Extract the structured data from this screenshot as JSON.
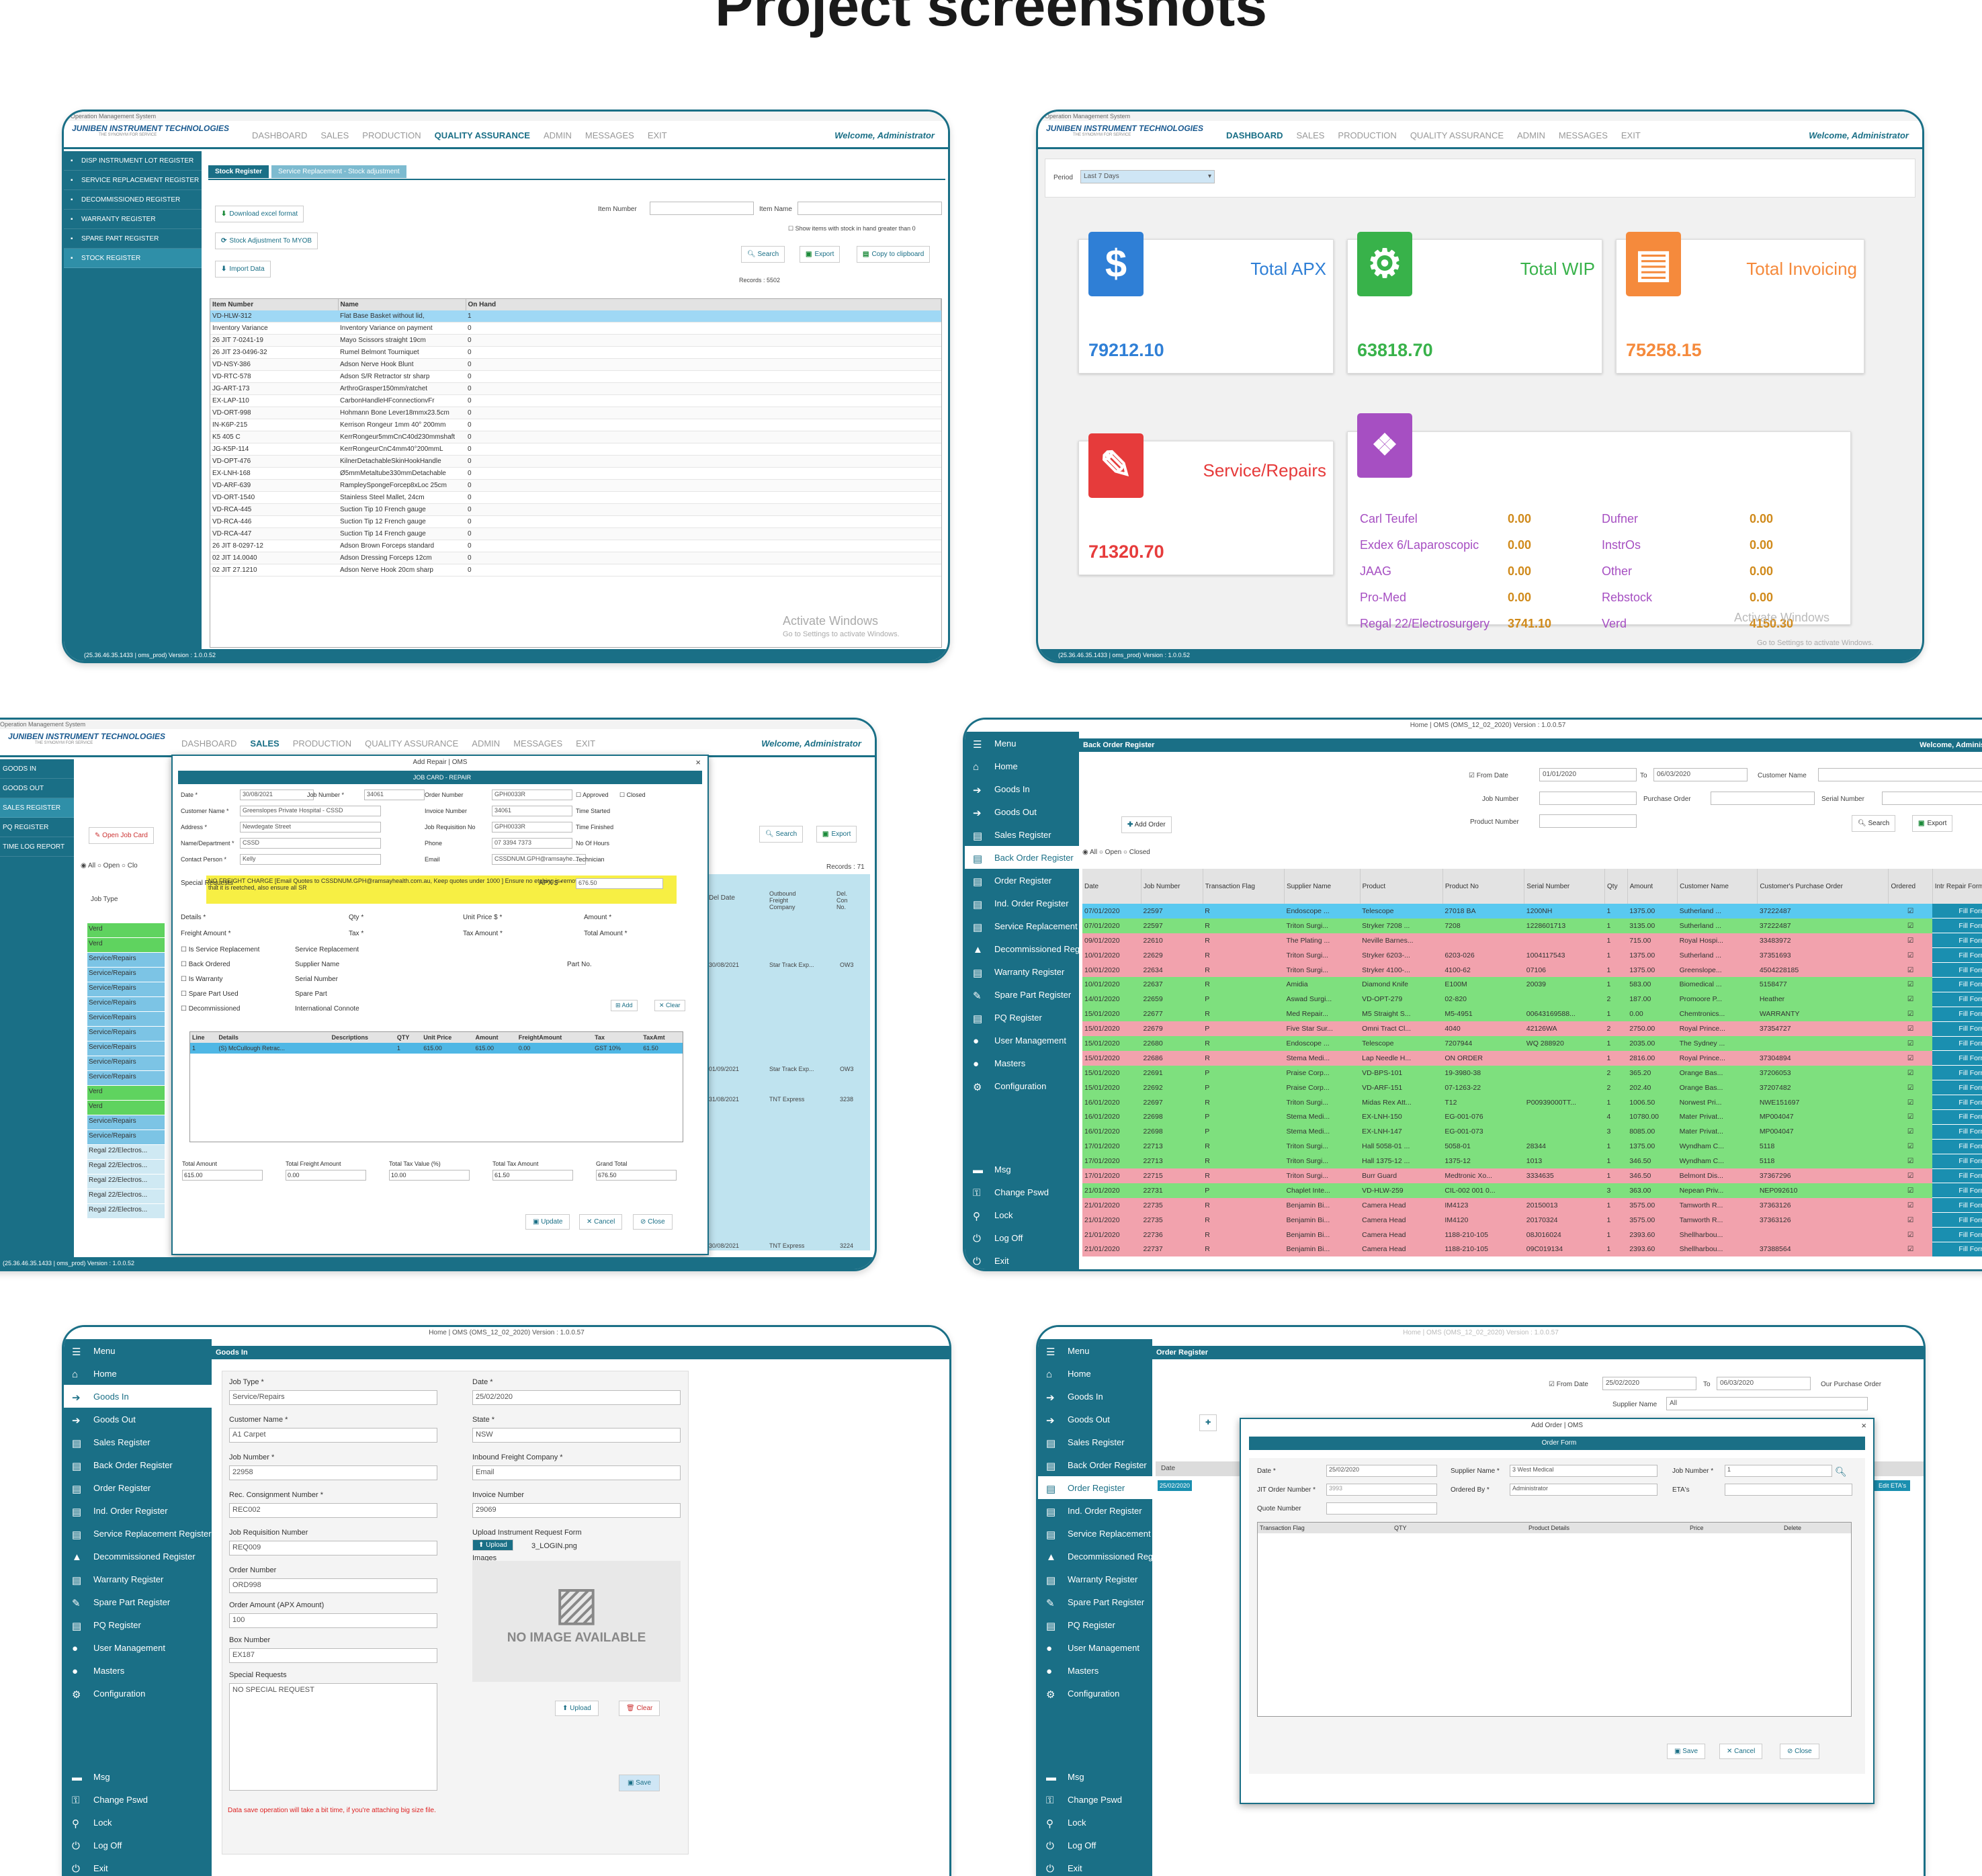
{
  "page_title": "Project screenshots",
  "common": {
    "window_title": "Operation Management System",
    "logo_text": "JUNIBEN INSTRUMENT TECHNOLOGIES",
    "logo_tagline": "THE SYNONYM FOR SERVICE",
    "welcome": "Welcome, Administrator",
    "nav": [
      "DASHBOARD",
      "SALES",
      "PRODUCTION",
      "QUALITY ASSURANCE",
      "ADMIN",
      "MESSAGES",
      "EXIT"
    ],
    "status": "(25.36.46.35.1433 | oms_prod) Version : 1.0.0.52",
    "activate": "Activate Windows",
    "activate_sub": "Go to Settings to activate Windows.",
    "menu_top_title": "Home | OMS (OMS_12_02_2020) Version : 1.0.0.57",
    "menu_label": "Menu",
    "lmenu": [
      "Home",
      "Goods In",
      "Goods Out",
      "Sales Register",
      "Back Order Register",
      "Order Register",
      "Ind. Order Register",
      "Service Replacement Register",
      "Decommissioned Register",
      "Warranty Register",
      "Spare Part Register",
      "PQ Register",
      "User Management",
      "Masters",
      "Configuration"
    ],
    "lmenu_bottom": [
      "Msg",
      "Change Pswd",
      "Lock",
      "Log Off",
      "Exit"
    ]
  },
  "shot1": {
    "side": [
      "DISP INSTRUMENT LOT REGISTER",
      "SERVICE REPLACEMENT REGISTER",
      "DECOMMISSIONED REGISTER",
      "WARRANTY REGISTER",
      "SPARE PART REGISTER",
      "STOCK REGISTER"
    ],
    "tabs": [
      "Stock Register",
      "Service Replacement - Stock adjustment"
    ],
    "download": "Download excel format",
    "adjust": "Stock Adjustment To MYOB",
    "import": "Import Data",
    "item_number_label": "Item Number",
    "item_name_label": "Item Name",
    "show_stock": "Show items with stock in hand greater than 0",
    "search": "Search",
    "export": "Export",
    "copy": "Copy to clipboard",
    "records": "Records : 5502",
    "columns": [
      "Item Number",
      "Name",
      "On Hand"
    ],
    "rows": [
      [
        "VD-HLW-312",
        "Flat Base Basket without lid,",
        "1"
      ],
      [
        "Inventory Variance",
        "Inventory Variance on payment",
        "0"
      ],
      [
        "26 JIT 7-0241-19",
        "Mayo Scissors straight 19cm",
        "0"
      ],
      [
        "26 JIT 23-0496-32",
        "Rumel Belmont Tourniquet",
        "0"
      ],
      [
        "VD-NSY-386",
        "Adson Nerve Hook Blunt",
        "0"
      ],
      [
        "VD-RTC-578",
        "Adson S/R Retractor str sharp",
        "0"
      ],
      [
        "JG-ART-173",
        "ArthroGrasper150mm/ratchet",
        "0"
      ],
      [
        "EX-LAP-110",
        "CarbonHandleHFconnectionvFr",
        "0"
      ],
      [
        "VD-ORT-998",
        "Hohmann Bone Lever18mmx23.5cm",
        "0"
      ],
      [
        "IN-K6P-215",
        "Kerrison Rongeur 1mm 40° 200mm",
        "0"
      ],
      [
        "K5 405 C",
        "KerrRongeur5mmCnC40d230mmshaft",
        "0"
      ],
      [
        "JG-K5P-114",
        "KerrRongeurCnC4mm40°200mmL",
        "0"
      ],
      [
        "VD-OPT-476",
        "KilnerDetachableSkinHookHandle",
        "0"
      ],
      [
        "EX-LNH-168",
        "Ø5mmMetaltube330mmDetachable",
        "0"
      ],
      [
        "VD-ARF-639",
        "RampleySpongeForcep8xLoc 25cm",
        "0"
      ],
      [
        "VD-ORT-1540",
        "Stainless Steel Mallet, 24cm",
        "0"
      ],
      [
        "VD-RCA-445",
        "Suction Tip 10 French gauge",
        "0"
      ],
      [
        "VD-RCA-446",
        "Suction Tip 12 French gauge",
        "0"
      ],
      [
        "VD-RCA-447",
        "Suction Tip 14 French gauge",
        "0"
      ],
      [
        "26 JIT 8-0297-12",
        "Adson Brown Forceps standard",
        "0"
      ],
      [
        "02 JIT 14.0040",
        "Adson Dressing Forceps 12cm",
        "0"
      ],
      [
        "02 JIT 27.1210",
        "Adson Nerve Hook 20cm sharp",
        "0"
      ]
    ]
  },
  "shot2": {
    "period_label": "Period",
    "period_value": "Last 7 Days",
    "cards": [
      {
        "title": "Total APX",
        "value": "79212.10",
        "color": "#2f7fd6",
        "icon": "$"
      },
      {
        "title": "Total WIP",
        "value": "63818.70",
        "color": "#38b24a",
        "icon": "⚙"
      },
      {
        "title": "Total Invoicing",
        "value": "75258.15",
        "color": "#f58a3c",
        "icon": "▤"
      },
      {
        "title": "Service/Repairs",
        "value": "71320.70",
        "color": "#e63b3b",
        "icon": "✎"
      }
    ],
    "stock": [
      [
        "Carl Teufel",
        "0.00",
        "Dufner",
        "0.00"
      ],
      [
        "Exdex 6/Laparoscopic",
        "0.00",
        "InstrOs",
        "0.00"
      ],
      [
        "JAAG",
        "0.00",
        "Other",
        "0.00"
      ],
      [
        "Pro-Med",
        "0.00",
        "Rebstock",
        "0.00"
      ],
      [
        "Regal 22/Electrosurgery",
        "3741.10",
        "Verd",
        "4150.30"
      ]
    ]
  },
  "shot3": {
    "side": [
      "GOODS IN",
      "GOODS OUT",
      "SALES REGISTER",
      "PQ REGISTER",
      "TIME LOG REPORT"
    ],
    "modal_title": "Add Repair | OMS",
    "job_card": "JOB CARD - REPAIR",
    "date": "30/08/2021",
    "job_number": "34061",
    "order_number": "GPH0033R",
    "customer": "Greenslopes Private Hospital - CSSD",
    "invoice_number": "34061",
    "address": "Newdegate Street",
    "job_req": "GPH0033R",
    "name_dept": "CSSD",
    "phone": "07 3394 7373",
    "contact": "Kelly",
    "email": "CSSDNUM.GPH@ramsayhe...",
    "special": "NO FREIGHT CHARGE [Email Quotes to CSSDNUM.GPH@ramsayhealth.com.au, Keep quotes under 1000 ] Ensure no etching is removed. If it inevitable please ensure that it is reetched, also ensure all SR",
    "apx": "676.50",
    "line_row": [
      "1",
      "(S) McCullough Retrac...",
      "",
      "1",
      "615.00",
      "615.00",
      "0.00",
      "GST 10%",
      "61.50"
    ],
    "line_cols": [
      "Line",
      "Details",
      "Descriptions",
      "QTY",
      "Unit Price",
      "Amount",
      "FreightAmount",
      "Tax",
      "TaxAmt"
    ],
    "totals_labels": [
      "Total Amount",
      "Total Freight Amount",
      "Total Tax Value (%)",
      "Total Tax Amount",
      "Grand Total"
    ],
    "totals": [
      "615.00",
      "0.00",
      "10.00",
      "61.50",
      "676.50"
    ],
    "update": "Update",
    "cancel": "Cancel",
    "close": "Close",
    "open_job": "Open Job Card",
    "search": "Search",
    "export": "Export",
    "records": "Records : 71",
    "job_types": [
      "Verd",
      "Verd",
      "Service/Repairs",
      "Service/Repairs",
      "Service/Repairs",
      "Service/Repairs",
      "Service/Repairs",
      "Service/Repairs",
      "Service/Repairs",
      "Service/Repairs",
      "Service/Repairs",
      "Verd",
      "Verd",
      "Service/Repairs",
      "Service/Repairs",
      "Regal 22/Electros...",
      "Regal 22/Electros...",
      "Regal 22/Electros...",
      "Regal 22/Electros...",
      "Regal 22/Electros..."
    ],
    "right_rows": [
      [
        "30/08/2021",
        "Star Track Exp...",
        "OW3"
      ],
      [
        "01/09/2021",
        "Star Track Exp...",
        "OW3"
      ],
      [
        "31/08/2021",
        "TNT Express",
        "3238"
      ],
      [
        "30/08/2021",
        "TNT Express",
        "3224"
      ],
      [
        "31/08/2021",
        "Star Track Exp...",
        "OW3"
      ]
    ]
  },
  "shot4": {
    "title": "Back Order Register",
    "from_date": "01/01/2020",
    "to_date": "06/03/2020",
    "add_order": "Add Order",
    "search": "Search",
    "export": "Export",
    "columns": [
      "Date",
      "Job Number",
      "Transaction Flag",
      "Supplier Name",
      "Product",
      "Product No",
      "Serial Number",
      "Qty",
      "Amount",
      "Customer Name",
      "Customer's Purchase Order",
      "Ordered",
      "Intr Repair Form"
    ],
    "rows": [
      [
        "07/01/2020",
        "22597",
        "R",
        "Endoscope ...",
        "Telescope",
        "27018 BA",
        "1200NH",
        "1",
        "1375.00",
        "Sutherland ...",
        "37222487",
        "b"
      ],
      [
        "07/01/2020",
        "22597",
        "R",
        "Triton Surgi...",
        "Stryker 7208 ...",
        "7208",
        "1228601713",
        "1",
        "3135.00",
        "Sutherland ...",
        "37222487",
        "g"
      ],
      [
        "09/01/2020",
        "22610",
        "R",
        "The Plating ...",
        "Neville Barnes...",
        "",
        "",
        "1",
        "715.00",
        "Royal Hospi...",
        "33483972",
        "r"
      ],
      [
        "10/01/2020",
        "22629",
        "R",
        "Triton Surgi...",
        "Stryker 6203-...",
        "6203-026",
        "1004117543",
        "1",
        "1375.00",
        "Sutherland ...",
        "37351693",
        "r"
      ],
      [
        "10/01/2020",
        "22634",
        "R",
        "Triton Surgi...",
        "Stryker 4100-...",
        "4100-62",
        "07106",
        "1",
        "1375.00",
        "Greenslope...",
        "4504228185",
        "r"
      ],
      [
        "10/01/2020",
        "22637",
        "R",
        "Amidia",
        "Diamond Knife",
        "E100M",
        "20039",
        "1",
        "583.00",
        "Biomedical ...",
        "5158477",
        "g"
      ],
      [
        "14/01/2020",
        "22659",
        "P",
        "Aswad Surgi...",
        "VD-OPT-279",
        "02-820",
        "",
        "2",
        "187.00",
        "Promoore P...",
        "Heather",
        "g"
      ],
      [
        "15/01/2020",
        "22677",
        "R",
        "Med Repair...",
        "M5 Straight S...",
        "M5-4951",
        "00643169588...",
        "1",
        "0.00",
        "Chemtronics...",
        "WARRANTY",
        "g"
      ],
      [
        "15/01/2020",
        "22679",
        "P",
        "Five Star Sur...",
        "Omni Tract Cl...",
        "4040",
        "42126WA",
        "2",
        "2750.00",
        "Royal Prince...",
        "37354727",
        "r"
      ],
      [
        "15/01/2020",
        "22680",
        "R",
        "Endoscope ...",
        "Telescope",
        "7207944",
        "WQ 288920",
        "1",
        "2035.00",
        "The Sydney ...",
        "",
        "g"
      ],
      [
        "15/01/2020",
        "22686",
        "R",
        "Stema Medi...",
        "Lap Needle H...",
        "ON ORDER",
        "",
        "1",
        "2816.00",
        "Royal Prince...",
        "37304894",
        "r"
      ],
      [
        "15/01/2020",
        "22691",
        "P",
        "Praise Corp...",
        "VD-BPS-101",
        "19-3980-38",
        "",
        "2",
        "365.20",
        "Orange Bas...",
        "37206053",
        "g"
      ],
      [
        "15/01/2020",
        "22692",
        "P",
        "Praise Corp...",
        "VD-ARF-151",
        "07-1263-22",
        "",
        "2",
        "202.40",
        "Orange Bas...",
        "37207482",
        "g"
      ],
      [
        "16/01/2020",
        "22697",
        "R",
        "Triton Surgi...",
        "Midas Rex Att...",
        "T12",
        "P00939000TT...",
        "1",
        "1006.50",
        "Norwest Pri...",
        "NWE151697",
        "g"
      ],
      [
        "16/01/2020",
        "22698",
        "P",
        "Stema Medi...",
        "EX-LNH-150",
        "EG-001-076",
        "",
        "4",
        "10780.00",
        "Mater Privat...",
        "MP004047",
        "g"
      ],
      [
        "16/01/2020",
        "22698",
        "P",
        "Stema Medi...",
        "EX-LNH-147",
        "EG-001-073",
        "",
        "3",
        "8085.00",
        "Mater Privat...",
        "MP004047",
        "g"
      ],
      [
        "17/01/2020",
        "22713",
        "R",
        "Triton Surgi...",
        "Hall 5058-01 ...",
        "5058-01",
        "28344",
        "1",
        "1375.00",
        "Wyndham C...",
        "5118",
        "g"
      ],
      [
        "17/01/2020",
        "22713",
        "R",
        "Triton Surgi...",
        "Hall 1375-12 ...",
        "1375-12",
        "1013",
        "1",
        "346.50",
        "Wyndham C...",
        "5118",
        "g"
      ],
      [
        "17/01/2020",
        "22715",
        "R",
        "Triton Surgi...",
        "Burr Guard",
        "Medtronic Xo...",
        "3334635",
        "1",
        "346.50",
        "Belmont Dis...",
        "37367296",
        "r"
      ],
      [
        "21/01/2020",
        "22731",
        "P",
        "Chaplet Inte...",
        "VD-HLW-259",
        "CIL-002 001 0...",
        "",
        "3",
        "363.00",
        "Nepean Priv...",
        "NEP092610",
        "g"
      ],
      [
        "21/01/2020",
        "22735",
        "R",
        "Benjamin Bi...",
        "Camera Head",
        "IM4123",
        "20150013",
        "1",
        "3575.00",
        "Tamworth R...",
        "37363126",
        "r"
      ],
      [
        "21/01/2020",
        "22735",
        "R",
        "Benjamin Bi...",
        "Camera Head",
        "IM4120",
        "20170324",
        "1",
        "3575.00",
        "Tamworth R...",
        "37363126",
        "r"
      ],
      [
        "21/01/2020",
        "22736",
        "R",
        "Benjamin Bi...",
        "Camera Head",
        "1188-210-105",
        "08J016024",
        "1",
        "2393.60",
        "Shellharbou...",
        "",
        "r"
      ],
      [
        "21/01/2020",
        "22737",
        "R",
        "Benjamin Bi...",
        "Camera Head",
        "1188-210-105",
        "09C019134",
        "1",
        "2393.60",
        "Shellharbou...",
        "37388564",
        "r"
      ]
    ],
    "fill_form": "Fill Form"
  },
  "shot5": {
    "title": "Goods In",
    "job_type": "Service/Repairs",
    "date": "25/02/2020",
    "customer": "A1 Carpet",
    "state": "NSW",
    "job_number": "22958",
    "freight": "Email",
    "consignment": "REC002",
    "invoice": "29069",
    "job_req": "REQ009",
    "upload_form": "3_LOGIN.png",
    "order_number": "ORD998",
    "order_amount": "100",
    "box": "EX187",
    "special": "NO SPECIAL REQUEST",
    "no_image": "NO IMAGE AVAILABLE",
    "upload": "Upload",
    "clear": "Clear",
    "save": "Save",
    "warn": "Data save operation will take a bit time, if you're attaching big size file."
  },
  "shot6": {
    "title": "Order Register",
    "from_date": "25/02/2020",
    "to_date": "06/03/2020",
    "supplier": "All",
    "modal_title": "Add Order | OMS",
    "form_bar": "Order Form",
    "date": "25/02/2020",
    "supplier_name": "3 West Medical",
    "job_number": "1",
    "jit_order": "3993",
    "ordered_by": "Administrator",
    "columns": [
      "Transaction Flag",
      "QTY",
      "Product Details",
      "Price",
      "Delete"
    ],
    "save": "Save",
    "cancel": "Cancel",
    "close": "Close",
    "edit_etas": "Edit ETA's"
  }
}
